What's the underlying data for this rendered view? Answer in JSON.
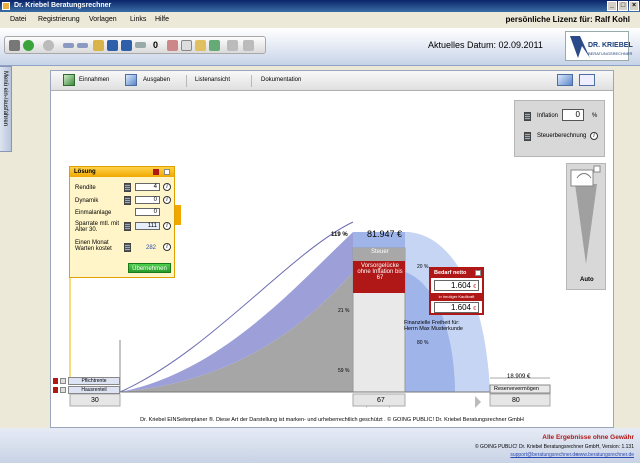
{
  "window": {
    "title": "Dr. Kriebel Beratungsrechner"
  },
  "menu": {
    "items": [
      "Datei",
      "Registrierung",
      "Vorlagen",
      "Links",
      "Hilfe"
    ]
  },
  "license_text": "persönliche Lizenz für: Ralf Kohl",
  "toolbar": {
    "counter": "0",
    "date_text": "Aktuelles Datum: 02.09.2011"
  },
  "logo": {
    "line1": "DR. KRIEBEL",
    "line2": "BERATUNGSRECHNER"
  },
  "sidebar": {
    "tab_label": "Menü ein-/ausfahren"
  },
  "content_toolbar": {
    "einnahmen": "Einnahmen",
    "ausgaben": "Ausgaben",
    "listenansicht": "Listenansicht",
    "dokumentation": "Dokumentation"
  },
  "inflation": {
    "label": "Inflation",
    "value": "0",
    "unit": "%",
    "steuer_label": "Steuerberechnung"
  },
  "slider": {
    "auto_label": "Auto"
  },
  "loesung": {
    "title": "Lösung",
    "rendite_label": "Rendite",
    "rendite_value": "4",
    "dynamik_label": "Dynamik",
    "dynamik_value": "0",
    "einmal_label": "Einmalanlage",
    "einmal_value": "0",
    "sparrate_label": "Sparrate mtl. mit Alter 30.",
    "sparrate_value": "111",
    "warten_label": "Einen Monat Warten kostet",
    "warten_value": "282",
    "apply_label": "Übernehmen"
  },
  "chart_labels": {
    "pct_119": "119 %",
    "amount_top": "81.947 €",
    "steuer": "Steuer",
    "vorsorge": "Vorsorgelücke ohne Inflation bis 67",
    "pct_21": "21 %",
    "pct_59": "59 %",
    "pct_20": "20 %",
    "pct_80": "80 %",
    "freiheit": "Finanzielle Freiheit für: Herrn Max Musterkunde",
    "amount_right": "18.909 €",
    "reserve": "Reservevermögen",
    "pflicht": "Pflichtrente",
    "hausrente": "Hausrenteil"
  },
  "bedarf": {
    "title": "Bedarf netto",
    "value1": "1.604",
    "unit": "€",
    "subtitle": "in heutiger Kaufkraft",
    "value2": "1.604"
  },
  "axis": {
    "start": "30",
    "middle": "67",
    "end": "80"
  },
  "copyright": "Dr. Kriebel EINSeitenplaner ®. Diese Art der Darstellung ist marken- und urheberrechtlich geschützt . © GOING PUBLIC! Dr. Kriebel Beratungsrechner GmbH",
  "footer": {
    "line1": "Alle Ergebnisse ohne Gewähr",
    "line2": "© GOING PUBLIC! Dr. Kriebel Beratungsrechner GmbH, Version: 1.131",
    "email": "support@beratungsrechner.de",
    "website": "www.beratungsrechner.de"
  },
  "colors": {
    "accent_red": "#b01818",
    "chart_blue": "#8fa3e0",
    "panel_gold": "#f0a800"
  }
}
